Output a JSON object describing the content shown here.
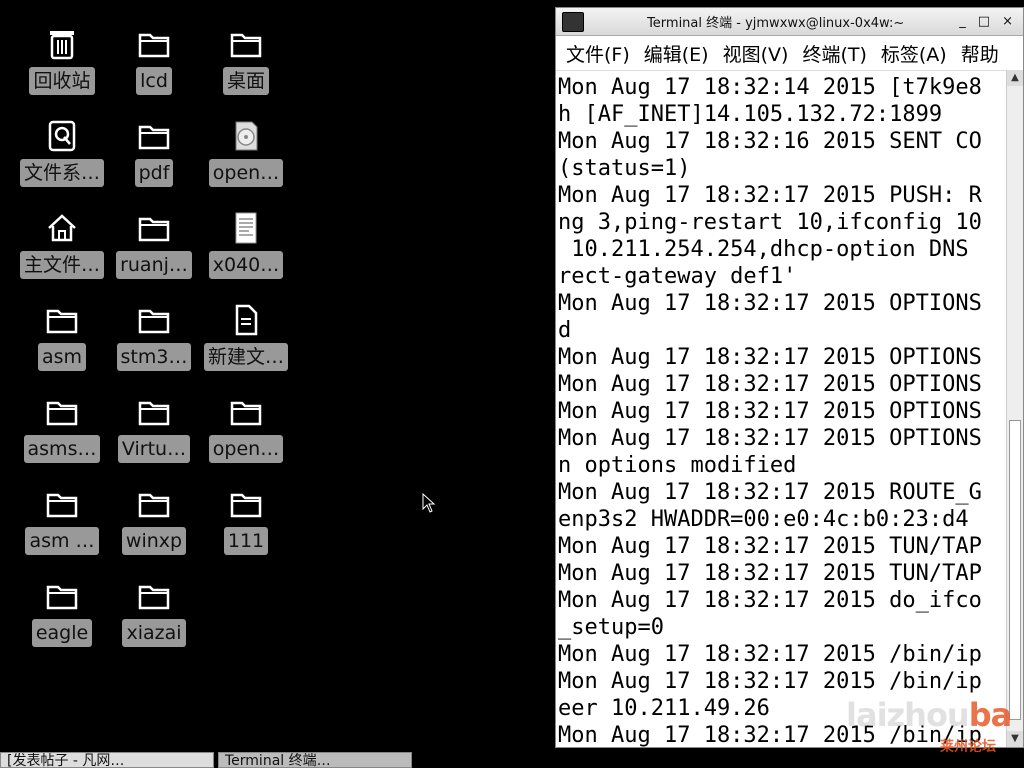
{
  "desktop": {
    "icons": [
      {
        "label": "回收站",
        "icon": "trash-icon"
      },
      {
        "label": "lcd",
        "icon": "folder-icon"
      },
      {
        "label": "桌面",
        "icon": "folder-icon"
      },
      {
        "label": "文件系…",
        "icon": "filesystem-icon"
      },
      {
        "label": "pdf",
        "icon": "folder-icon"
      },
      {
        "label": "open…",
        "icon": "disc-icon"
      },
      {
        "label": "主文件…",
        "icon": "home-icon"
      },
      {
        "label": "ruanj…",
        "icon": "folder-icon"
      },
      {
        "label": "x040…",
        "icon": "document-icon"
      },
      {
        "label": "asm",
        "icon": "folder-icon"
      },
      {
        "label": "stm3…",
        "icon": "folder-icon"
      },
      {
        "label": "新建文…",
        "icon": "file-icon"
      },
      {
        "label": "asms…",
        "icon": "folder-icon"
      },
      {
        "label": "Virtu…",
        "icon": "folder-icon"
      },
      {
        "label": "open…",
        "icon": "folder-icon"
      },
      {
        "label": "asm …",
        "icon": "folder-icon"
      },
      {
        "label": "winxp",
        "icon": "folder-icon"
      },
      {
        "label": "111",
        "icon": "folder-icon"
      },
      {
        "label": "eagle",
        "icon": "folder-icon"
      },
      {
        "label": "xiazai",
        "icon": "folder-icon"
      }
    ]
  },
  "terminal": {
    "title": "Terminal 终端 - yjmwxwx@linux-0x4w:~",
    "window_buttons": [
      "_",
      "□",
      "×"
    ],
    "menu": [
      "文件(F)",
      "编辑(E)",
      "视图(V)",
      "终端(T)",
      "标签(A)",
      "帮助"
    ],
    "lines": [
      "Mon Aug 17 18:32:14 2015 [t7k9e8",
      "h [AF_INET]14.105.132.72:1899",
      "Mon Aug 17 18:32:16 2015 SENT CO",
      "(status=1)",
      "Mon Aug 17 18:32:17 2015 PUSH: R",
      "ng 3,ping-restart 10,ifconfig 10",
      " 10.211.254.254,dhcp-option DNS",
      "rect-gateway def1'",
      "Mon Aug 17 18:32:17 2015 OPTIONS",
      "d",
      "Mon Aug 17 18:32:17 2015 OPTIONS",
      "Mon Aug 17 18:32:17 2015 OPTIONS",
      "Mon Aug 17 18:32:17 2015 OPTIONS",
      "Mon Aug 17 18:32:17 2015 OPTIONS",
      "n options modified",
      "Mon Aug 17 18:32:17 2015 ROUTE_G",
      "enp3s2 HWADDR=00:e0:4c:b0:23:d4",
      "Mon Aug 17 18:32:17 2015 TUN/TAP",
      "Mon Aug 17 18:32:17 2015 TUN/TAP",
      "Mon Aug 17 18:32:17 2015 do_ifco",
      "_setup=0",
      "Mon Aug 17 18:32:17 2015 /bin/ip",
      "Mon Aug 17 18:32:17 2015 /bin/ip",
      "eer 10.211.49.26",
      "Mon Aug 17 18:32:17 2015 /bin/ip"
    ]
  },
  "watermark": {
    "main": "laizhou",
    "accent": "ba",
    "sub": "莱州论坛"
  },
  "taskbar": {
    "tasks": [
      {
        "label": "[发表帖子 - 凡网…"
      },
      {
        "label": "Terminal 终端…"
      }
    ]
  },
  "colors": {
    "desktop_bg": "#000000",
    "label_bg": "#999999",
    "terminal_bg": "#ffffff"
  }
}
